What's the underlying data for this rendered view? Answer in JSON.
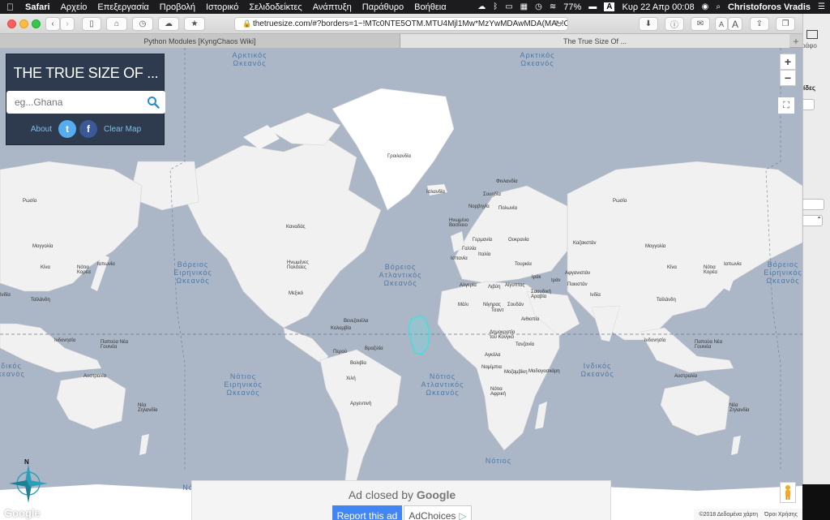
{
  "menubar": {
    "app": "Safari",
    "items": [
      "Αρχείο",
      "Επεξεργασία",
      "Προβολή",
      "Ιστορικό",
      "Σελιδοδείκτες",
      "Ανάπτυξη",
      "Παράθυρο",
      "Βοήθεια"
    ],
    "battery": "77%",
    "datetime": "Κυρ 22 Απρ 00:08",
    "user": "Christoforos Vradis",
    "input_source": "A"
  },
  "browser": {
    "url": "thetruesize.com/#?borders=1~!MTc0NTE5OTM.MTU4Mjl1Mw*MzYwMDAwMDA(MA~!C",
    "tabs": [
      "Python Modules [KyngChaos Wiki]",
      "The True Size Of ..."
    ],
    "reader_small": "A",
    "reader_large": "A"
  },
  "panel": {
    "title": "THE TRUE SIZE OF ...",
    "search_placeholder": "eg...Ghana",
    "about": "About",
    "twitter": "t",
    "facebook": "f",
    "clear_map": "Clear Map"
  },
  "map": {
    "zoom_in": "+",
    "zoom_out": "−",
    "compass_n": "N",
    "google": "Google",
    "attribution": "©2018 Δεδομένα χάρτη",
    "terms": "Όροι Χρήσης",
    "oceans": {
      "arctic_left": "Αρκτικός\nΩκεανός",
      "arctic_right": "Αρκτικός\nΩκεανός",
      "n_pacific_left": "Βόρειος\nΕιρηνικός\nΩκεανός",
      "n_pacific_right": "Βόρειος\nΕιρηνικός\nΩκεανός",
      "n_atlantic": "Βόρειος\nΑτλαντικός\nΩκεανός",
      "s_pacific": "Νότιος\nΕιρηνικός\nΩκεανός",
      "s_atlantic": "Νότιος\nΑτλαντικός\nΩκεανός",
      "indian_right": "Ινδικός\nΩκεανός",
      "indian_left": "δικός\nκεανός",
      "south_bottom": "Νότιος",
      "south_left": "Νό"
    },
    "countries": {
      "greenland": "Γροιλανδία",
      "iceland": "Ισλανδία",
      "finland": "Φινλανδία",
      "sweden": "Σουηδία",
      "norway": "Νορβηγία",
      "poland": "Πολωνία",
      "uk": "Ηνωμένο\nΒασίλειο",
      "germany": "Γερμανία",
      "ukraine": "Ουκρανία",
      "france": "Γαλλία",
      "italy": "Ιταλία",
      "spain": "Ισπανία",
      "turkey": "Τουρκία",
      "kazakhstan": "Καζακστάν",
      "mongolia_r": "Μογγολία",
      "russia_r": "Ρωσία",
      "russia_l": "Ρωσία",
      "mongolia_l": "Μογγολία",
      "china_l": "Κίνα",
      "china_r": "Κίνα",
      "japan_l": "Ιαπωνία",
      "japan_r": "Ιαπωνία",
      "s_korea_l": "Νότια\nΚορέα",
      "s_korea_r": "Νότια\nΚορέα",
      "india_l": "Ινδία",
      "india_r": "Ινδία",
      "thailand_l": "Ταϊλάνδη",
      "thailand_r": "Ταϊλάνδη",
      "afghanistan": "Αφγανιστάν",
      "pakistan": "Πακιστάν",
      "iran": "Ιράν",
      "iraq": "Ιράκ",
      "saudi": "Σαουδική\nΑραβία",
      "egypt": "Αίγυπτος",
      "libya": "Λιβύη",
      "algeria": "Αλγερία",
      "mali": "Μάλι",
      "niger": "Νίγηρας",
      "chad": "Τσαντ",
      "sudan": "Σουδάν",
      "ethiopia": "Αιθιοπία",
      "drc": "Δημοκρατία\nτου Κονγκό",
      "tanzania": "Τανζανία",
      "angola": "Αγκόλα",
      "namibia": "Ναμίμπια",
      "mozambique": "Μοζαμβίκη",
      "south_africa": "Νότια\nΑφρική",
      "madagascar": "Μαδαγασκάρη",
      "canada": "Καναδάς",
      "usa": "Ηνωμένες\nΠολιτείες",
      "mexico": "Μεξικό",
      "venezuela": "Βενεζουέλα",
      "colombia": "Κολομβία",
      "peru": "Περού",
      "brazil": "Βραζιλία",
      "bolivia": "Βολιβία",
      "chile": "Χιλή",
      "argentina": "Αργεντινή",
      "indonesia_l": "Ινδονησία",
      "indonesia_r": "Ινδονησία",
      "png_l": "Παπούα Νέα\nΓουινέα",
      "png_r": "Παπούα Νέα\nΓουινέα",
      "australia_l": "Αυστραλία",
      "australia_r": "Αυστραλία",
      "nz_l": "Νέα\nΖηλανδία",
      "nz_r": "Νέα\nΖηλανδία"
    }
  },
  "ad": {
    "closed_by": "Ad closed by",
    "google": "Google",
    "report": "Report this ad",
    "adchoices": "AdChoices"
  },
  "side_window": {
    "text1": "ράφο",
    "text2": "ίδες"
  }
}
